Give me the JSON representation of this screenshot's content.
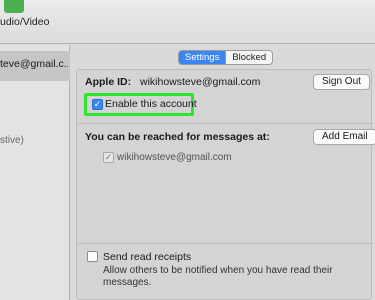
{
  "toolbar": {
    "label": "udio/Video",
    "icon": "facetime-video-icon",
    "icon_color": "#4caf50"
  },
  "sidebar": {
    "account_email": "teve@gmail.c...",
    "account_status": "stive)"
  },
  "tabs": [
    {
      "label": "Settings",
      "active": true
    },
    {
      "label": "Blocked",
      "active": false
    }
  ],
  "settings": {
    "apple_id_label": "Apple ID:",
    "apple_id_value": "wikihowsteve@gmail.com",
    "sign_out_label": "Sign Out",
    "enable_account_label": "Enable this account",
    "enable_account_checked": true,
    "reach_label": "You can be reached for messages at:",
    "add_email_label": "Add Email",
    "reach_addresses": [
      {
        "address": "wikihowsteve@gmail.com",
        "checked": true
      }
    ],
    "send_read_receipts_label": "Send read receipts",
    "send_read_receipts_checked": false,
    "send_read_receipts_desc": "Allow others to be notified when you have read their messages."
  },
  "colors": {
    "accent": "#3b86f0",
    "highlight": "#2ee62e"
  }
}
